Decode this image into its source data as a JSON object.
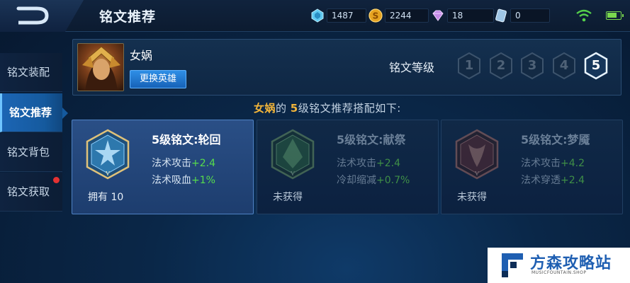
{
  "header": {
    "title": "铭文推荐",
    "resources": [
      {
        "icon": "crystal-icon",
        "value": "1487"
      },
      {
        "icon": "gold-coin-icon",
        "value": "2244"
      },
      {
        "icon": "diamond-icon",
        "value": "18"
      },
      {
        "icon": "voucher-icon",
        "value": "0"
      }
    ]
  },
  "sidebar": {
    "items": [
      {
        "label": "铭文装配",
        "active": false
      },
      {
        "label": "铭文推荐",
        "active": true
      },
      {
        "label": "铭文背包",
        "active": false
      },
      {
        "label": "铭文获取",
        "active": false,
        "badge": true
      }
    ]
  },
  "hero": {
    "name": "女娲",
    "change_label": "更换英雄",
    "level_label": "铭文等级",
    "levels": [
      "1",
      "2",
      "3",
      "4",
      "5"
    ],
    "selected_level": "5"
  },
  "recommendation": {
    "hero": "女娲",
    "connector": "的 ",
    "level": "5",
    "suffix": "级铭文推荐搭配如下:"
  },
  "cards": [
    {
      "title": "5级铭文:轮回",
      "stats": [
        {
          "label": "法术攻击",
          "value": "+2.4"
        },
        {
          "label": "法术吸血",
          "value": "+1%"
        }
      ],
      "owned": "拥有 10",
      "selected": true
    },
    {
      "title": "5级铭文:献祭",
      "stats": [
        {
          "label": "法术攻击",
          "value": "+2.4"
        },
        {
          "label": "冷却缩减",
          "value": "+0.7%"
        }
      ],
      "owned": "未获得",
      "selected": false
    },
    {
      "title": "5级铭文:梦魇",
      "stats": [
        {
          "label": "法术攻击",
          "value": "+4.2"
        },
        {
          "label": "法术穿透",
          "value": "+2.4"
        }
      ],
      "owned": "未获得",
      "selected": false
    }
  ],
  "watermark": {
    "name": "方森攻略站",
    "sub": "MUSICFOUNTAIN.SHOP"
  },
  "colors": {
    "accent": "#1c65b4",
    "gold": "#f2b53a",
    "stat_green": "#57dd4c"
  }
}
